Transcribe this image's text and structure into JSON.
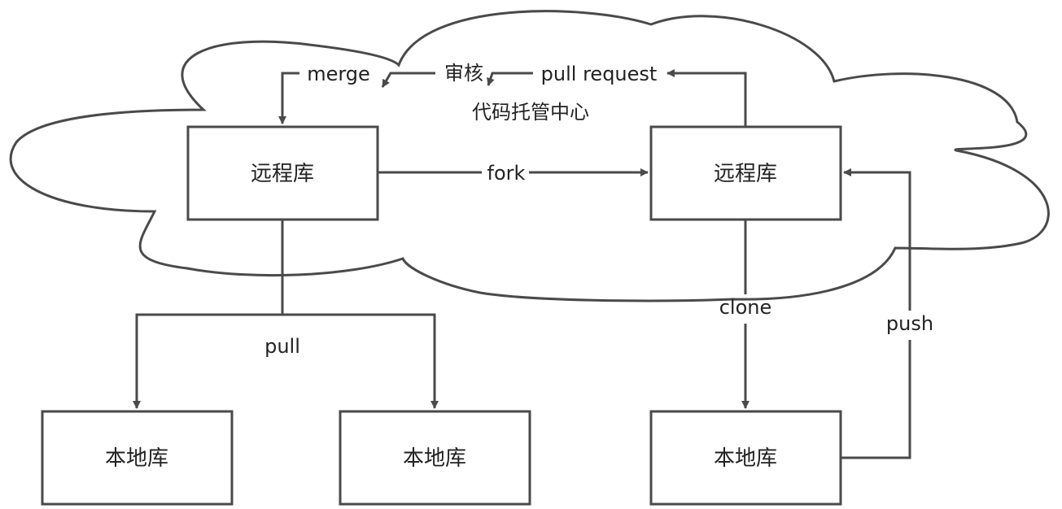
{
  "cloud_label": "代码托管中心",
  "boxes": {
    "remote_upstream": "远程库",
    "remote_fork": "远程库",
    "local_1": "本地库",
    "local_2": "本地库",
    "local_3": "本地库"
  },
  "edges": {
    "merge": "merge",
    "review": "审核",
    "pull_request": "pull request",
    "fork": "fork",
    "pull": "pull",
    "clone": "clone",
    "push": "push"
  },
  "colors": {
    "stroke": "#4a4a4a",
    "text": "#222222",
    "background": "#ffffff"
  }
}
